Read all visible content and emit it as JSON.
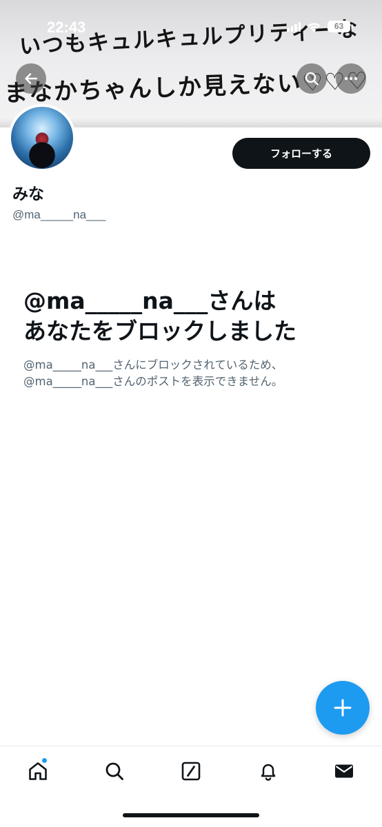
{
  "status_bar": {
    "time": "22:43",
    "battery": "63",
    "icons": [
      "signal-icon",
      "wifi-icon",
      "battery-icon"
    ]
  },
  "banner": {
    "line1": "いつもキュルキュルプリティーな",
    "line2": "まなかちゃんしか見えない♡♡♡"
  },
  "header": {
    "icons": [
      "back-arrow-icon",
      "search-icon",
      "more-icon"
    ]
  },
  "profile": {
    "follow_label": "フォローする",
    "display_name": "みな",
    "handle": "@ma_____na___"
  },
  "blocked": {
    "title_line1": "@ma_____na___さんは",
    "title_line2": "あなたをブロックしました",
    "desc_line1": "@ma_____na___さんにブロックされているため、",
    "desc_line2": "@ma_____na___さんのポストを表示できません。"
  },
  "fab": {
    "icon": "plus-icon"
  },
  "tab_bar": {
    "tabs": [
      "home-icon",
      "search-icon",
      "grok-icon",
      "bell-icon",
      "mail-icon"
    ],
    "home_has_notification": true
  },
  "colors": {
    "accent": "#1d9bf0",
    "text_primary": "#0f1419",
    "text_secondary": "#536471",
    "button_dark": "#0f1419"
  }
}
